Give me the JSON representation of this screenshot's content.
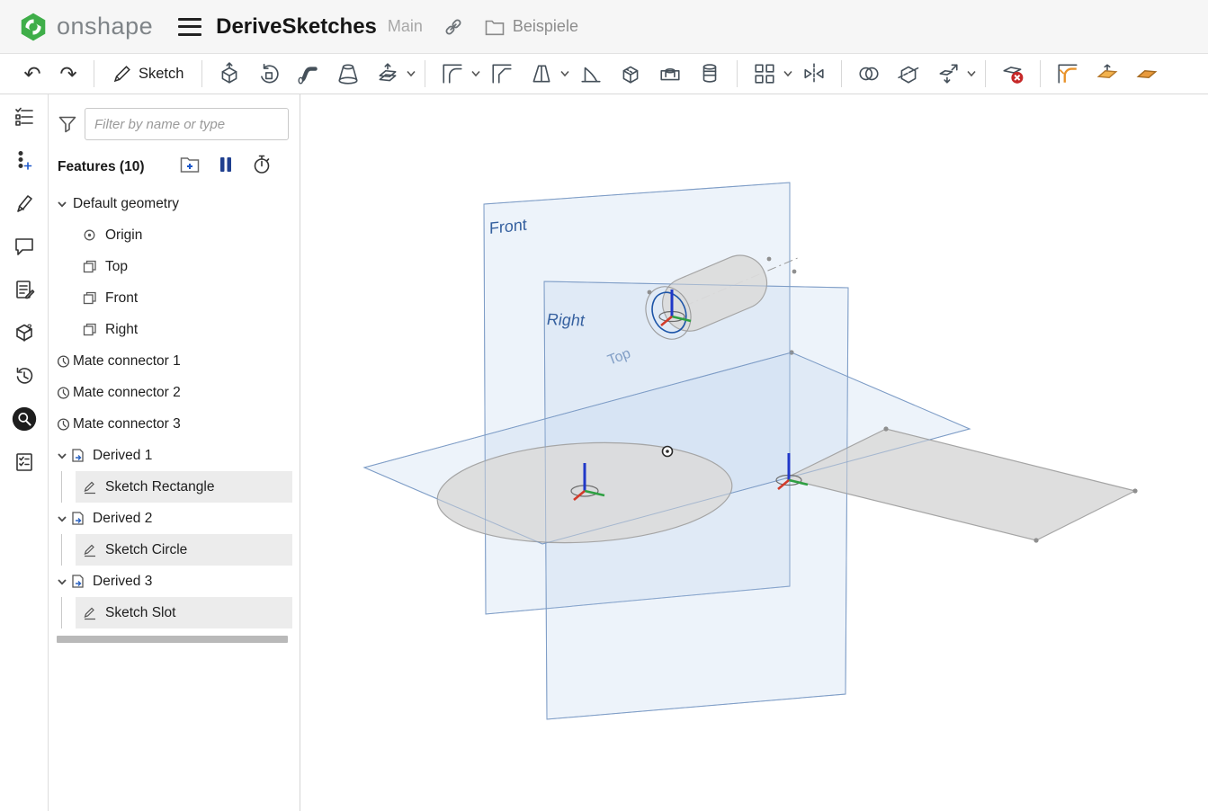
{
  "header": {
    "logo_text": "onshape",
    "document_title": "DeriveSketches",
    "workspace_label": "Main",
    "folder_label": "Beispiele"
  },
  "toolbar": {
    "sketch_label": "Sketch",
    "icons": [
      "undo",
      "redo",
      "sketch",
      "extrude",
      "revolve",
      "sweep",
      "loft",
      "thicken",
      "fillet",
      "chamfer",
      "draft",
      "rib",
      "shell",
      "hole",
      "thread",
      "linear-pattern",
      "mirror",
      "boolean",
      "split",
      "transform",
      "delete-part",
      "modify-fillet",
      "move-face"
    ]
  },
  "left_rail": {
    "icons": [
      "feature-list",
      "configurations",
      "markup",
      "comments",
      "notes",
      "learning-center",
      "history",
      "search",
      "action-items"
    ]
  },
  "feature_panel": {
    "filter_placeholder": "Filter by name or type",
    "features_header": "Features (10)",
    "tree": [
      {
        "label": "Default geometry",
        "type": "group",
        "expanded": true
      },
      {
        "label": "Origin",
        "type": "origin",
        "level": 1
      },
      {
        "label": "Top",
        "type": "plane",
        "level": 1
      },
      {
        "label": "Front",
        "type": "plane",
        "level": 1
      },
      {
        "label": "Right",
        "type": "plane",
        "level": 1
      },
      {
        "label": "Mate connector 1",
        "type": "mate-connector"
      },
      {
        "label": "Mate connector 2",
        "type": "mate-connector"
      },
      {
        "label": "Mate connector 3",
        "type": "mate-connector"
      },
      {
        "label": "Derived 1",
        "type": "derived",
        "expanded": true
      },
      {
        "label": "Sketch Rectangle",
        "type": "sketch",
        "level": 1,
        "selected": true
      },
      {
        "label": "Derived 2",
        "type": "derived",
        "expanded": true
      },
      {
        "label": "Sketch Circle",
        "type": "sketch",
        "level": 1,
        "selected": true
      },
      {
        "label": "Derived 3",
        "type": "derived",
        "expanded": true
      },
      {
        "label": "Sketch Slot",
        "type": "sketch",
        "level": 1,
        "selected": true
      }
    ]
  },
  "viewport": {
    "plane_labels": {
      "front": "Front",
      "right": "Right",
      "top": "Top"
    }
  },
  "colors": {
    "brand_green": "#3fae49",
    "plane_blue": "#7d9cc6",
    "plane_label_blue": "#35609f",
    "axis_blue": "#2038c8",
    "axis_green": "#2fa043",
    "axis_red": "#d23b2a",
    "selection_bg": "#ececec",
    "delete_red": "#c62828"
  }
}
